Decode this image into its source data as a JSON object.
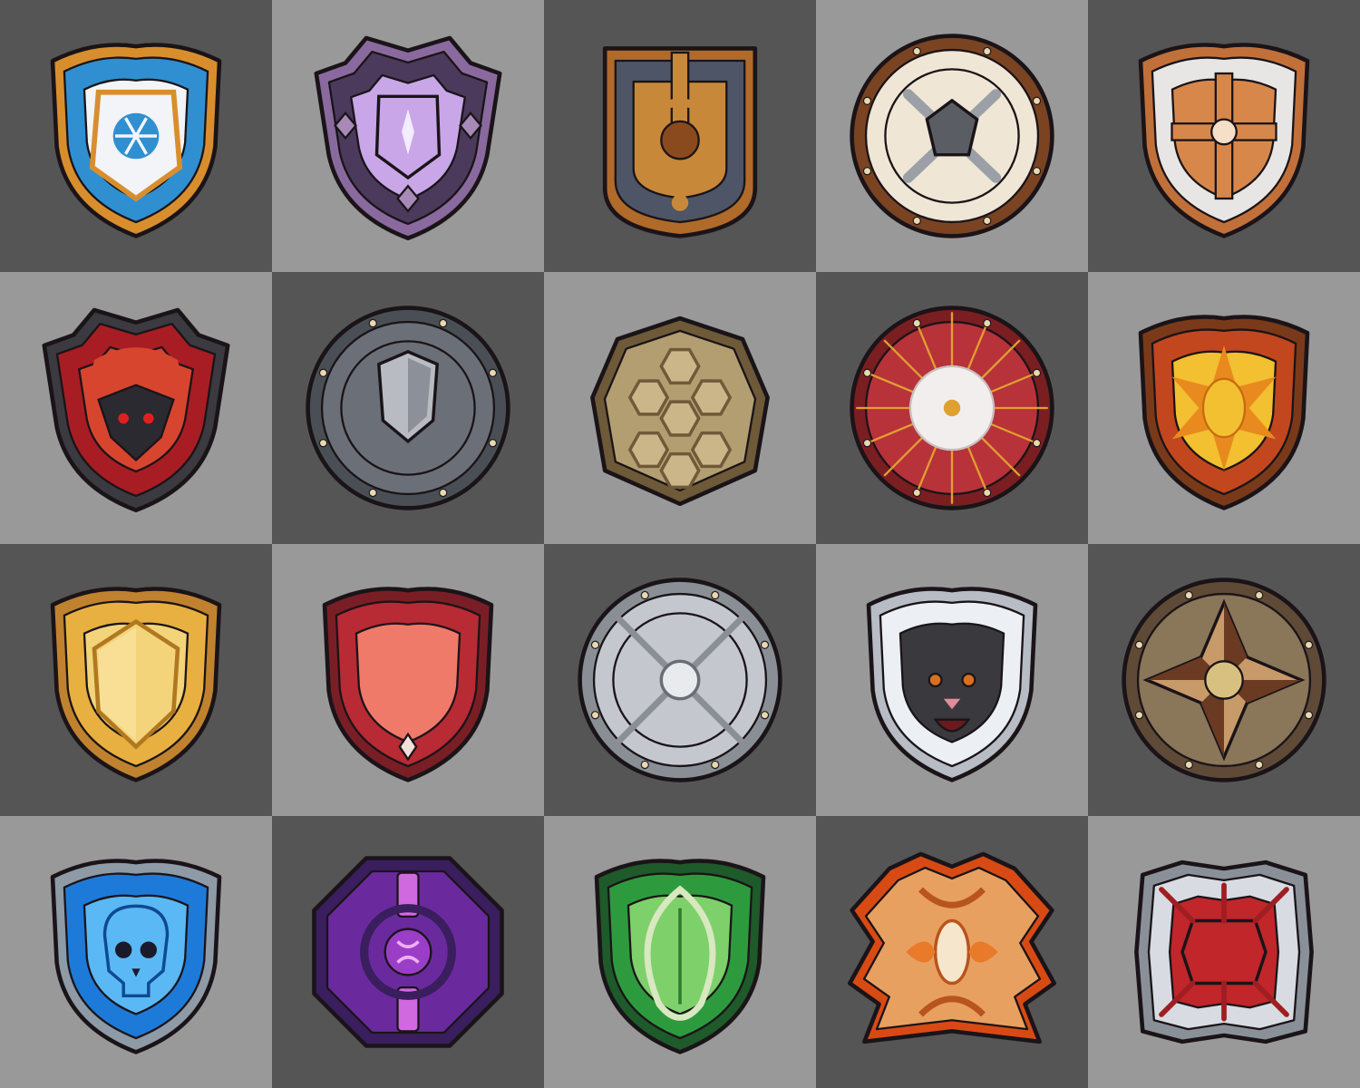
{
  "background": {
    "dark": "#555555",
    "light": "#999999"
  },
  "sheet": {
    "columns": 5,
    "rows": 4
  },
  "items": [
    {
      "icon": "frost-crest-shield-icon",
      "kind": "heater",
      "rim": "#d98e2e",
      "field": "#2f8fd1",
      "inner": "#f2f4f8",
      "emblem": "snowflake"
    },
    {
      "icon": "amethyst-spiked-shield-icon",
      "kind": "spiked",
      "rim": "#8a6a9e",
      "field": "#4b3a5c",
      "inner": "#c8a6e8",
      "emblem": "gem"
    },
    {
      "icon": "bronze-dial-tower-shield-icon",
      "kind": "tower",
      "rim": "#b06a2a",
      "field": "#4d5566",
      "inner": "#c8883a",
      "emblem": "dial"
    },
    {
      "icon": "crossed-bones-round-shield-icon",
      "kind": "round",
      "rim": "#7a4322",
      "field": "#f0e6d6",
      "inner": "#9aa0a6",
      "emblem": "crossbones"
    },
    {
      "icon": "holy-cross-shield-icon",
      "kind": "heater",
      "rim": "#c2703a",
      "field": "#e8e6e4",
      "inner": "#d8874a",
      "emblem": "cross"
    },
    {
      "icon": "crimson-demon-shield-icon",
      "kind": "spiked",
      "rim": "#3a3a40",
      "field": "#a81d24",
      "inner": "#d8452e",
      "emblem": "demon"
    },
    {
      "icon": "iron-guard-round-shield-icon",
      "kind": "round",
      "rim": "#4a4e55",
      "field": "#6b7078",
      "inner": "#b8bcc2",
      "emblem": "shield"
    },
    {
      "icon": "turtle-shell-shield-icon",
      "kind": "shell",
      "rim": "#6e5a38",
      "field": "#b39e72",
      "inner": "#cbb68a",
      "emblem": "plates"
    },
    {
      "icon": "crimson-parasol-shield-icon",
      "kind": "parasol",
      "rim": "#7a1e22",
      "field": "#b8323a",
      "inner": "#f2eeee",
      "emblem": "flower"
    },
    {
      "icon": "flame-sigil-shield-icon",
      "kind": "heater",
      "rim": "#7a3a1a",
      "field": "#c2461e",
      "inner": "#f2c030",
      "emblem": "sun"
    },
    {
      "icon": "golden-kite-shield-icon",
      "kind": "heater",
      "rim": "#c0822e",
      "field": "#e8b040",
      "inner": "#f4d47a",
      "emblem": "kite"
    },
    {
      "icon": "ruby-heater-shield-icon",
      "kind": "heater",
      "rim": "#7a1e26",
      "field": "#b82a34",
      "inner": "#f07a6a",
      "emblem": "shine"
    },
    {
      "icon": "steel-buckler-shield-icon",
      "kind": "round",
      "rim": "#8a8f96",
      "field": "#c4c8ce",
      "inner": "#e8eaee",
      "emblem": "cross-x"
    },
    {
      "icon": "white-tiger-shield-icon",
      "kind": "heater",
      "rim": "#b8bcc4",
      "field": "#eceff3",
      "inner": "#3a3a3e",
      "emblem": "tiger"
    },
    {
      "icon": "bronze-compass-round-shield-icon",
      "kind": "round",
      "rim": "#5e4a36",
      "field": "#8a7658",
      "inner": "#c89a6a",
      "emblem": "compass"
    },
    {
      "icon": "azure-skull-shield-icon",
      "kind": "heater",
      "rim": "#8e9aa6",
      "field": "#1e7ad8",
      "inner": "#5ab8f4",
      "emblem": "skull"
    },
    {
      "icon": "arcane-violet-shield-icon",
      "kind": "octagon",
      "rim": "#3a1e5e",
      "field": "#6a2a9e",
      "inner": "#d068e0",
      "emblem": "rune"
    },
    {
      "icon": "jade-leaf-shield-icon",
      "kind": "heater",
      "rim": "#1e5a2a",
      "field": "#2e9a3e",
      "inner": "#7ed06a",
      "emblem": "leaf"
    },
    {
      "icon": "phoenix-flame-shield-icon",
      "kind": "flame",
      "rim": "#d84a14",
      "field": "#e8a060",
      "inner": "#f6d4a6",
      "emblem": "phoenix"
    },
    {
      "icon": "thorned-silver-shield-icon",
      "kind": "square",
      "rim": "#8a9098",
      "field": "#d8dce2",
      "inner": "#c0262a",
      "emblem": "thorns"
    }
  ]
}
